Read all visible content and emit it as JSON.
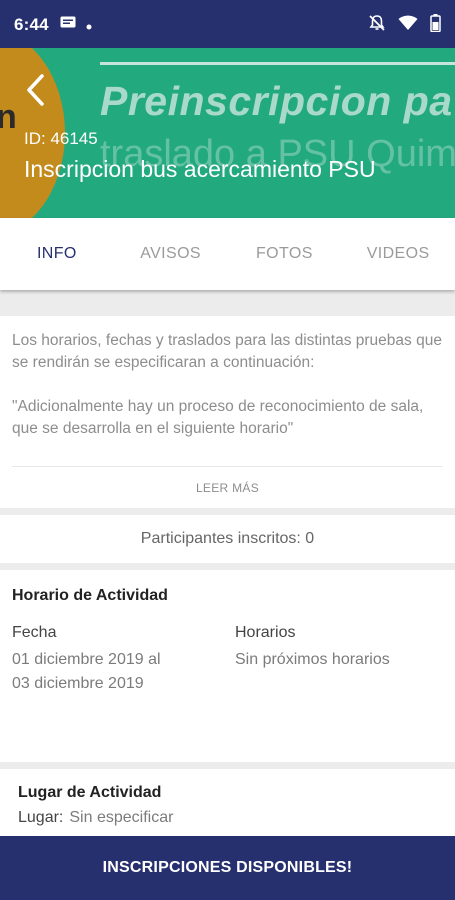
{
  "status_bar": {
    "time": "6:44"
  },
  "banner": {
    "letter": "n",
    "background_line1": "Preinscripcion pa",
    "background_line2": "traslado a PSU Quim",
    "id_text": "ID: 46145",
    "title": "Inscripcion bus acercamiento PSU"
  },
  "tabs": [
    "INFO",
    "AVISOS",
    "FOTOS",
    "VIDEOS"
  ],
  "description": {
    "paragraph1": "Los horarios, fechas y traslados para las distintas pruebas que se rendirán se especificaran a continuación:",
    "paragraph2": "\"Adicionalmente hay un proceso de reconocimiento de sala, que se desarrolla en el siguiente horario\"",
    "read_more": "LEER MÁS"
  },
  "participants": {
    "text": "Participantes inscritos: 0"
  },
  "schedule": {
    "title": "Horario de Actividad",
    "date_label": "Fecha",
    "date_line1": "01 diciembre 2019 al",
    "date_line2": "03 diciembre 2019",
    "hours_label": "Horarios",
    "hours_value": "Sin próximos horarios"
  },
  "location": {
    "title": "Lugar de Actividad",
    "label": "Lugar:",
    "value": "Sin especificar"
  },
  "bottom_button": {
    "label": "INSCRIPCIONES DISPONIBLES!"
  },
  "colors": {
    "primary": "#27306f",
    "banner_green": "#22a97e",
    "banner_orange": "#c38b1c"
  },
  "icons": [
    "message-icon",
    "dot-icon",
    "mute-icon",
    "wifi-icon",
    "battery-icon",
    "back-arrow-icon"
  ]
}
